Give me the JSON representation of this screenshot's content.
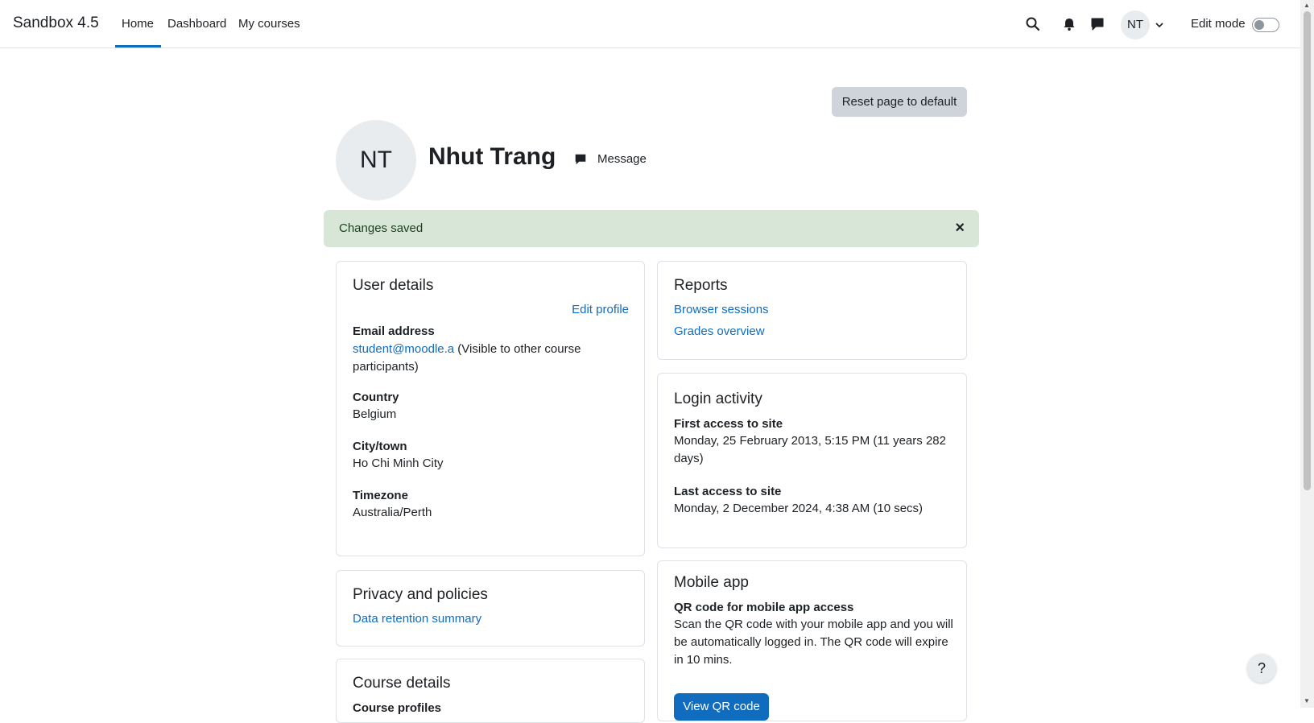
{
  "navbar": {
    "brand": "Sandbox 4.5",
    "items": [
      {
        "label": "Home",
        "active": true
      },
      {
        "label": "Dashboard",
        "active": false
      },
      {
        "label": "My courses",
        "active": false
      }
    ],
    "avatar_initials": "NT",
    "edit_mode_label": "Edit mode",
    "edit_mode_on": false
  },
  "page": {
    "reset_button": "Reset page to default",
    "avatar_initials": "NT",
    "fullname": "Nhut Trang",
    "message_label": "Message"
  },
  "alert": {
    "text": "Changes saved",
    "close": "×"
  },
  "user_details": {
    "title": "User details",
    "edit_profile": "Edit profile",
    "email_label": "Email address",
    "email_value": "student@moodle.a",
    "email_visibility_line1": " (Visible to other course",
    "email_visibility_line2": "participants)",
    "country_label": "Country",
    "country_value": "Belgium",
    "city_label": "City/town",
    "city_value": "Ho Chi Minh City",
    "timezone_label": "Timezone",
    "timezone_value": "Australia/Perth"
  },
  "reports": {
    "title": "Reports",
    "links": [
      "Browser sessions",
      "Grades overview"
    ]
  },
  "login_activity": {
    "title": "Login activity",
    "first_label": "First access to site",
    "first_value_line1": "Monday, 25 February 2013, 5:15 PM  (11 years 282",
    "first_value_line2": "days)",
    "last_label": "Last access to site",
    "last_value": "Monday, 2 December 2024, 4:38 AM  (10 secs)"
  },
  "privacy": {
    "title": "Privacy and policies",
    "link": "Data retention summary"
  },
  "mobile_app": {
    "title": "Mobile app",
    "qr_label": "QR code for mobile app access",
    "desc_line1": "Scan the QR code with your mobile app and you will",
    "desc_line2": "be automatically logged in. The QR code will expire",
    "desc_line3": "in 10 mins.",
    "button": "View QR code"
  },
  "course_details": {
    "title": "Course details",
    "profiles_label": "Course profiles"
  },
  "help": {
    "label": "?"
  },
  "colors": {
    "accent": "#0f6cbf",
    "alert_bg": "#d7e6d7",
    "button_secondary": "#ced4da"
  }
}
